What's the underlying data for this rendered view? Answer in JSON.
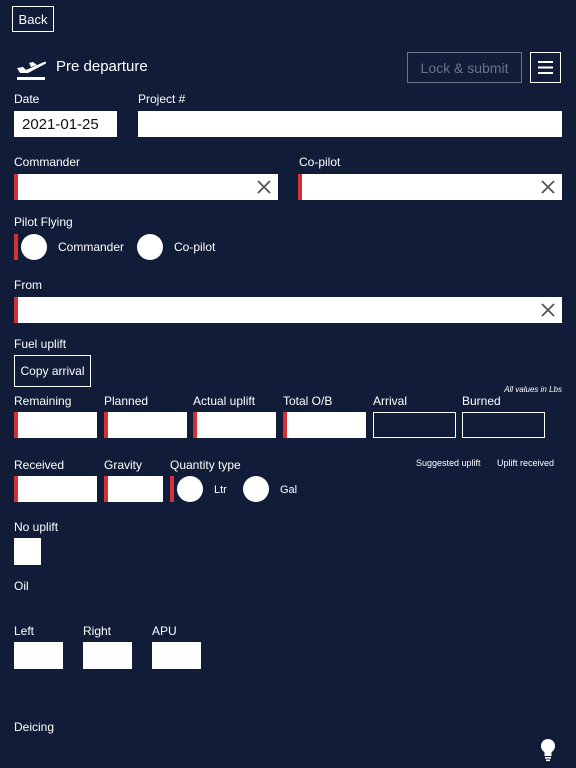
{
  "nav": {
    "back_label": "Back"
  },
  "header": {
    "title": "Pre departure",
    "lock_submit_label": "Lock & submit"
  },
  "fields": {
    "date": {
      "label": "Date",
      "value": "2021-01-25"
    },
    "project": {
      "label": "Project #",
      "value": ""
    },
    "commander": {
      "label": "Commander",
      "value": ""
    },
    "copilot": {
      "label": "Co-pilot",
      "value": ""
    },
    "from": {
      "label": "From",
      "value": ""
    }
  },
  "pilot_flying": {
    "label": "Pilot Flying",
    "options": [
      "Commander",
      "Co-pilot"
    ]
  },
  "fuel": {
    "section_label": "Fuel uplift",
    "copy_arrival_label": "Copy arrival",
    "units_note": "All values in Lbs",
    "row1": [
      "Remaining",
      "Planned",
      "Actual uplift",
      "Total O/B",
      "Arrival",
      "Burned"
    ],
    "received_label": "Received",
    "gravity_label": "Gravity",
    "quantity_type_label": "Quantity type",
    "quantity_options": [
      "Ltr",
      "Gal"
    ],
    "suggested_uplift_label": "Suggested uplift",
    "uplift_received_label": "Uplift received",
    "no_uplift_label": "No uplift"
  },
  "oil": {
    "section_label": "Oil",
    "fields": [
      "Left",
      "Right",
      "APU"
    ]
  },
  "deicing": {
    "section_label": "Deicing"
  },
  "icons": {
    "header": "airplane-departure-icon",
    "menu": "hamburger-menu-icon",
    "clear": "close-icon",
    "hint": "lightbulb-icon"
  },
  "colors": {
    "background": "#111d38",
    "required": "#d62f35",
    "disabled": "#6b7488"
  }
}
